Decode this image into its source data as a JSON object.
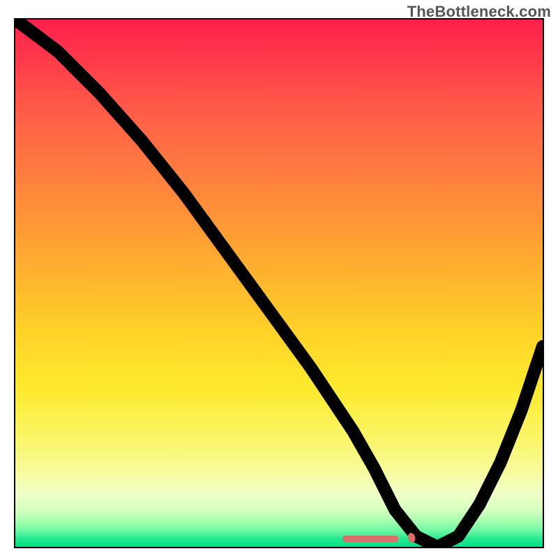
{
  "watermark": "TheBottleneck.com",
  "chart_data": {
    "type": "line",
    "title": "",
    "xlabel": "",
    "ylabel": "",
    "xlim": [
      0,
      100
    ],
    "ylim": [
      0,
      100
    ],
    "grid": false,
    "legend": false,
    "background_gradient": {
      "top": "#ff1f4b",
      "mid": "#ffd428",
      "bottom": "#00e085",
      "meaning": "bottleneck severity (red high, green low)"
    },
    "series": [
      {
        "name": "bottleneck-curve",
        "color": "#000000",
        "x": [
          0,
          8,
          16,
          24,
          32,
          40,
          48,
          56,
          60,
          64,
          68,
          72,
          76,
          80,
          84,
          88,
          92,
          96,
          100
        ],
        "values": [
          100,
          94,
          86,
          77,
          67,
          56,
          45,
          34,
          28,
          22,
          15,
          7,
          2,
          0,
          2,
          8,
          16,
          26,
          38
        ]
      }
    ],
    "annotations": [
      {
        "type": "min-region-marker",
        "color": "#d9706a",
        "x_range": [
          72,
          84
        ],
        "y": 0
      }
    ]
  }
}
